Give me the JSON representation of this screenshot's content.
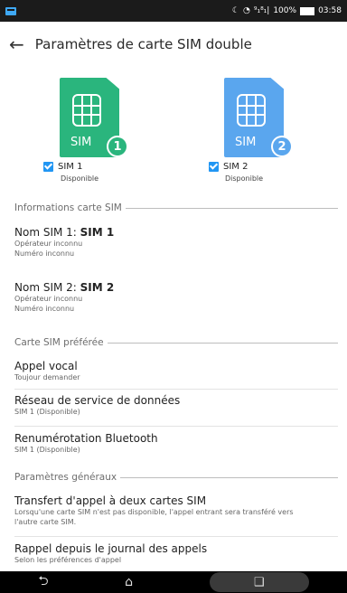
{
  "status_bar": {
    "time": "03:58",
    "battery": "100%",
    "signal_text": "⁹₁⁸₁|",
    "icons": [
      "message-icon",
      "do-not-disturb-icon",
      "wifi-icon",
      "signal-icon",
      "battery-icon"
    ]
  },
  "header": {
    "back_icon": "arrow-left-icon",
    "title": "Paramètres de carte SIM double"
  },
  "sims": [
    {
      "card_label": "SIM",
      "badge": "1",
      "color": "#2ab57d",
      "checked": true,
      "name": "SIM 1",
      "status": "Disponible"
    },
    {
      "card_label": "SIM",
      "badge": "2",
      "color": "#5aa6ee",
      "checked": true,
      "name": "SIM 2",
      "status": "Disponible"
    }
  ],
  "sections": {
    "info": {
      "header": "Informations carte SIM",
      "items": [
        {
          "title_prefix": "Nom SIM 1: ",
          "title_bold": "SIM 1",
          "lines": [
            "Opérateur inconnu",
            "Numéro inconnu"
          ]
        },
        {
          "title_prefix": "Nom SIM 2: ",
          "title_bold": "SIM 2",
          "lines": [
            "Opérateur inconnu",
            "Numéro inconnu"
          ]
        }
      ]
    },
    "preferred": {
      "header": "Carte SIM préférée",
      "items": [
        {
          "title": "Appel vocal",
          "subtitle": "Toujour demander"
        },
        {
          "title": "Réseau de service de données",
          "subtitle": "SIM 1 (Disponible)"
        },
        {
          "title": "Renumérotation Bluetooth",
          "subtitle": "SIM 1 (Disponible)"
        }
      ]
    },
    "general": {
      "header": "Paramètres généraux",
      "items": [
        {
          "title": "Transfert d'appel à deux cartes SIM",
          "subtitle_1": "Lorsqu'une carte SIM n'est pas disponible, l'appel entrant sera transféré vers",
          "subtitle_2": "l'autre carte SIM."
        },
        {
          "title": "Rappel depuis le journal des appels",
          "subtitle": "Selon les préférences d'appel"
        }
      ]
    }
  },
  "nav_bar": {
    "back": "⮌",
    "home": "⌂",
    "recents": "❑"
  }
}
